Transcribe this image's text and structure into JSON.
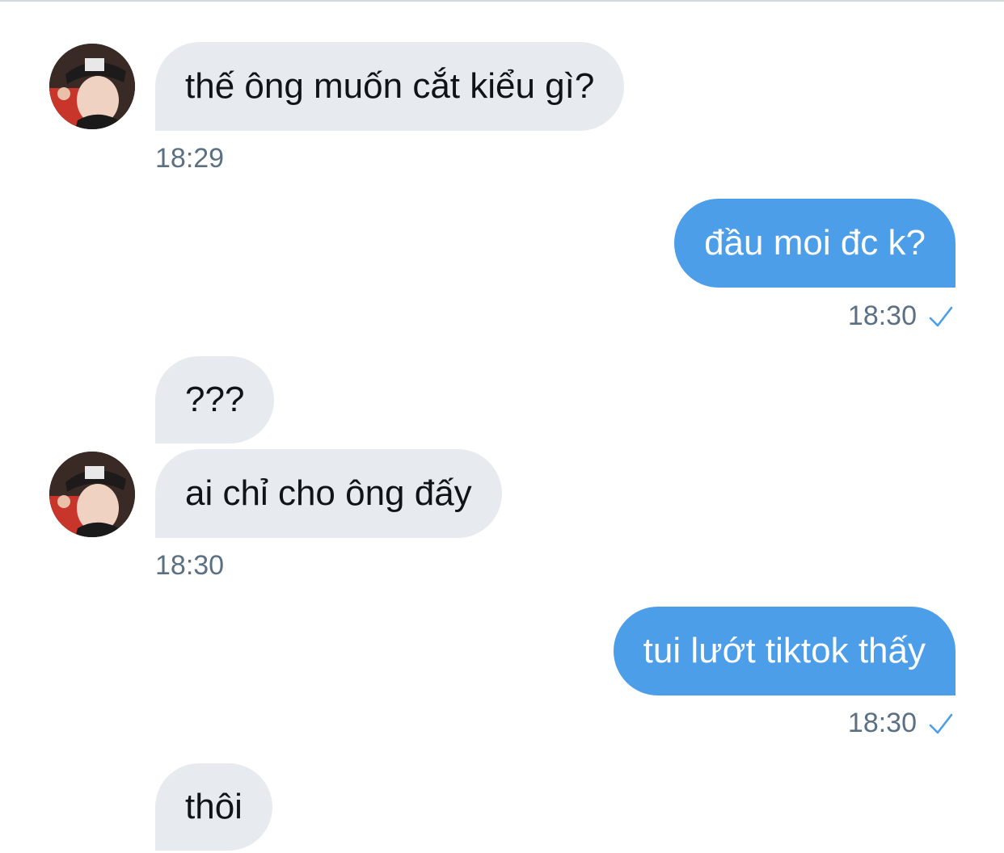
{
  "messages": [
    {
      "side": "in",
      "text": "thế ông muốn cắt kiểu gì?",
      "time": "18:29"
    },
    {
      "side": "out",
      "text": "đầu moi đc k?",
      "time": "18:30",
      "status_icon": "check-icon"
    },
    {
      "side": "in",
      "text": "???"
    },
    {
      "side": "in",
      "text": "ai chỉ cho ông đấy",
      "time": "18:30"
    },
    {
      "side": "out",
      "text": "tui lướt tiktok thấy",
      "time": "18:30",
      "status_icon": "check-icon"
    },
    {
      "side": "in",
      "text": "thôi"
    }
  ],
  "colors": {
    "incoming_bubble": "#e7ebef",
    "outgoing_bubble": "#4c9ee8",
    "timestamp": "#5b7083",
    "check": "#4c9ee8"
  }
}
